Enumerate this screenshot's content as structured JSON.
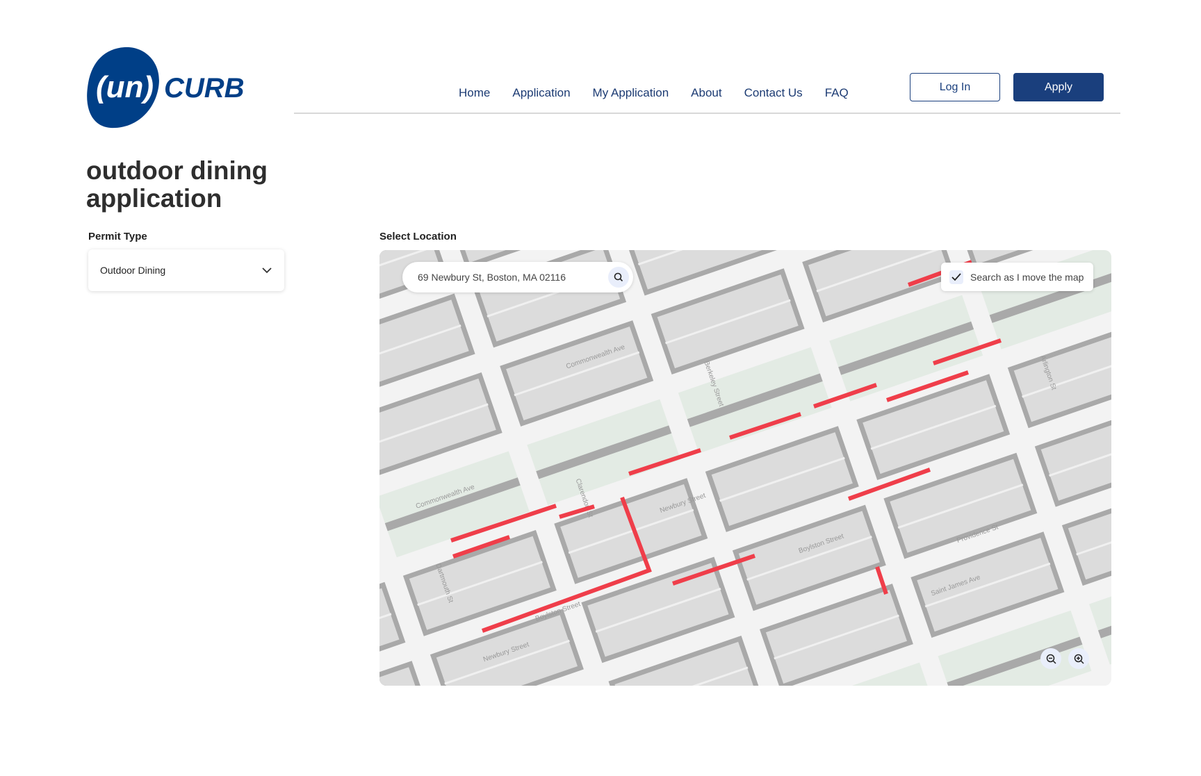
{
  "brand": {
    "logo_text": "(un)CURB",
    "color": "#003f87"
  },
  "nav": {
    "items": [
      "Home",
      "Application",
      "My Application",
      "About",
      "Contact Us",
      "FAQ"
    ]
  },
  "auth": {
    "login": "Log In",
    "apply": "Apply"
  },
  "page": {
    "title": "outdoor dining application"
  },
  "permit": {
    "label": "Permit Type",
    "value": "Outdoor Dining"
  },
  "location": {
    "label": "Select Location",
    "search_value": "69 Newbury St, Boston, MA 02116",
    "search_as_move": "Search as I move the map",
    "search_as_move_checked": true
  },
  "map": {
    "highlight_color": "#ef3e4a",
    "labels": [
      "Commonwealth Ave",
      "Commonwealth Ave",
      "Newbury Street",
      "Newbury Street",
      "Boylston Street",
      "Boylston Street",
      "Clarendon St",
      "Berkeley Street",
      "Arlington St",
      "Dartmouth St",
      "Saint James Ave",
      "Providence St"
    ]
  }
}
